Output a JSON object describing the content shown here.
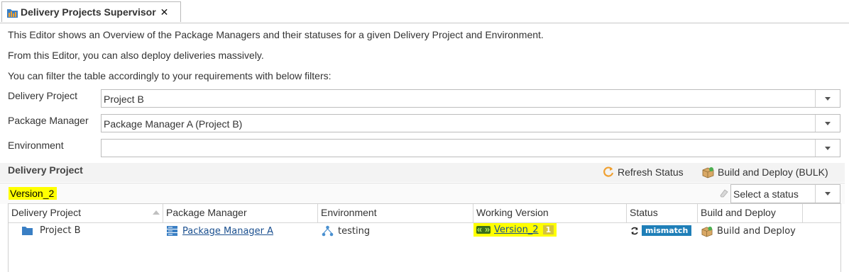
{
  "tab": {
    "title": "Delivery Projects Supervisor",
    "close": "✕"
  },
  "intro": {
    "line1": "This Editor shows an Overview of the Package Managers and their statuses for a given Delivery Project and Environment.",
    "line2": "From this Editor, you can also deploy deliveries massively.",
    "line3": "You can filter the table accordingly to your requirements with below filters:"
  },
  "filters": {
    "delivery_project": {
      "label": "Delivery Project",
      "value": "Project B"
    },
    "package_manager": {
      "label": "Package Manager",
      "value": "Package Manager A (Project B)"
    },
    "environment": {
      "label": "Environment",
      "value": ""
    }
  },
  "section": {
    "title": "Delivery Project",
    "refresh_label": "Refresh Status",
    "build_bulk_label": "Build and Deploy (BULK)"
  },
  "filterbar": {
    "search_value": "Version_2",
    "status_placeholder": "Select a status"
  },
  "table": {
    "headers": [
      "Delivery Project",
      "Package Manager",
      "Environment",
      "Working Version",
      "Status",
      "Build and Deploy"
    ],
    "rows": [
      {
        "delivery_project": "Project B",
        "package_manager": "Package Manager A",
        "environment": "testing",
        "working_version": "Version_2",
        "version_count": "1",
        "status": "mismatch",
        "action": "Build and Deploy"
      }
    ]
  },
  "colors": {
    "highlight": "#ffff00",
    "badge": "#1f7fb8",
    "link": "#1a4f8f"
  }
}
